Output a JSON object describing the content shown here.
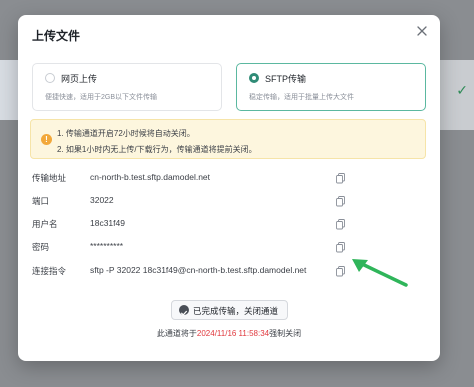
{
  "dialog": {
    "title": "上传文件"
  },
  "upload_modes": [
    {
      "label": "网页上传",
      "description": "便捷快速，适用于2GB以下文件传输",
      "selected": false
    },
    {
      "label": "SFTP传输",
      "description": "稳定传输，适用于批量上传大文件",
      "selected": true
    }
  ],
  "notice": {
    "line1": "1. 传输通道开启72小时候将自动关闭。",
    "line2": "2. 如果1小时内无上传/下载行为，传输通道将提前关闭。"
  },
  "fields": [
    {
      "label": "传输地址",
      "value": "cn-north-b.test.sftp.damodel.net"
    },
    {
      "label": "端口",
      "value": "32022"
    },
    {
      "label": "用户名",
      "value": "18c31f49"
    },
    {
      "label": "密码",
      "value": "**********"
    },
    {
      "label": "连接指令",
      "value": "sftp -P 32022 18c31f49@cn-north-b.test.sftp.damodel.net"
    }
  ],
  "done_button": {
    "label": "已完成传输，关闭通道"
  },
  "expiry": {
    "prefix": "此通道将于",
    "timestamp": "2024/11/16 11:58:34",
    "suffix": "强制关闭"
  },
  "colors": {
    "accent": "#2f8b76",
    "warning_bg": "#fdf6de",
    "warning_icon": "#f2a83a",
    "expiry_time": "#e0393e",
    "annotation_arrow": "#2fb55a"
  }
}
